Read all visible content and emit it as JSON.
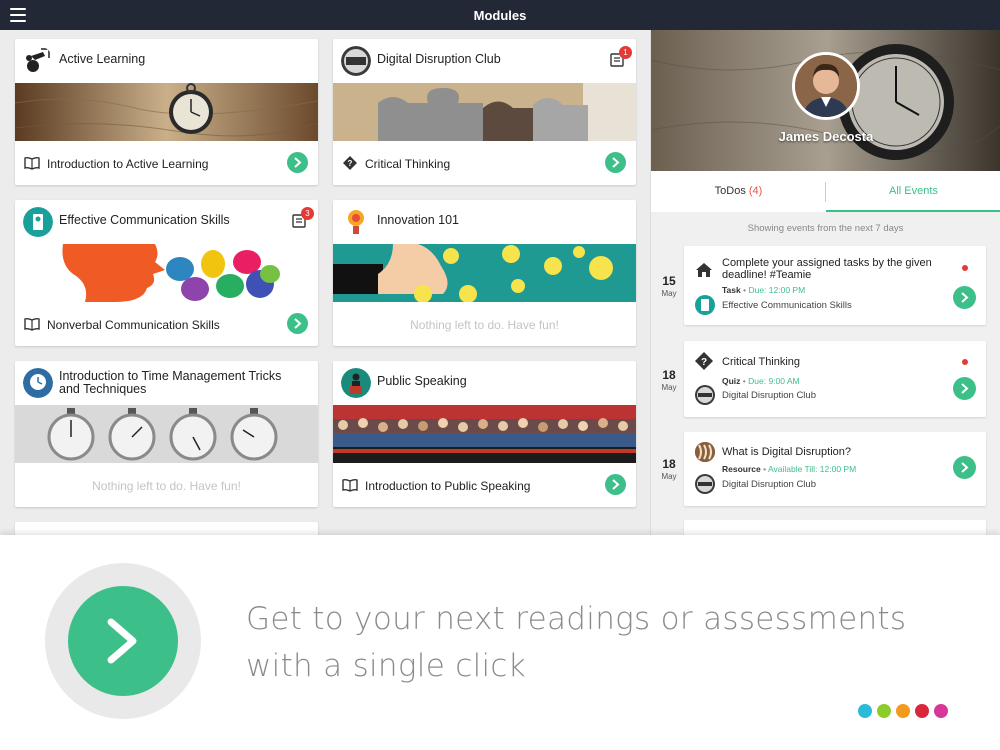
{
  "header": {
    "title": "Modules"
  },
  "modules": [
    {
      "title": "Active Learning",
      "footer": "Introduction to Active Learning",
      "footer_icon": "book-icon",
      "empty": ""
    },
    {
      "title": "Digital Disruption Club",
      "badge": "1",
      "footer": "Critical Thinking",
      "footer_icon": "quiz-icon",
      "empty": ""
    },
    {
      "title": "Effective Communication Skills",
      "badge": "3",
      "footer": "Nonverbal Communication Skills",
      "footer_icon": "book-icon",
      "empty": ""
    },
    {
      "title": "Innovation 101",
      "footer": "",
      "empty": "Nothing left to do. Have fun!"
    },
    {
      "title": "Introduction to Time Management Tricks and Techniques",
      "footer": "",
      "empty": "Nothing left to do. Have fun!"
    },
    {
      "title": "Public Speaking",
      "footer": "Introduction to Public Speaking",
      "footer_icon": "book-icon",
      "empty": ""
    }
  ],
  "profile": {
    "name": "James Decosta"
  },
  "tabs": {
    "todos_label": "ToDos",
    "todos_count": "(4)",
    "events_label": "All Events"
  },
  "showing": "Showing events from the next 7 days",
  "events": [
    {
      "day": "15",
      "month": "May",
      "title": "Complete your assigned tasks by the given deadline!  #Teamie",
      "type": "Task",
      "sep": " • ",
      "when": "Due: 12:00 PM",
      "course": "Effective Communication Skills",
      "icon": "home-icon",
      "unread": true
    },
    {
      "day": "18",
      "month": "May",
      "title": "Critical Thinking",
      "type": "Quiz",
      "sep": " • ",
      "when": "Due: 9:00 AM",
      "course": "Digital Disruption Club",
      "icon": "quiz-icon",
      "unread": true
    },
    {
      "day": "18",
      "month": "May",
      "title": "What is Digital Disruption?",
      "type": "Resource",
      "sep": " • ",
      "when": "Available Till: 12:00 PM",
      "course": "Digital Disruption Club",
      "icon": "resource-icon",
      "unread": false
    }
  ],
  "promo": {
    "tagline": "Get to your next readings or assessments with a single click",
    "dot_colors": [
      "#2bbbd8",
      "#8ccc2b",
      "#f39a1d",
      "#d9283b",
      "#d8379a"
    ]
  },
  "colors": {
    "accent": "#3dbf8a",
    "topbar": "#232837",
    "badge": "#e53935"
  }
}
